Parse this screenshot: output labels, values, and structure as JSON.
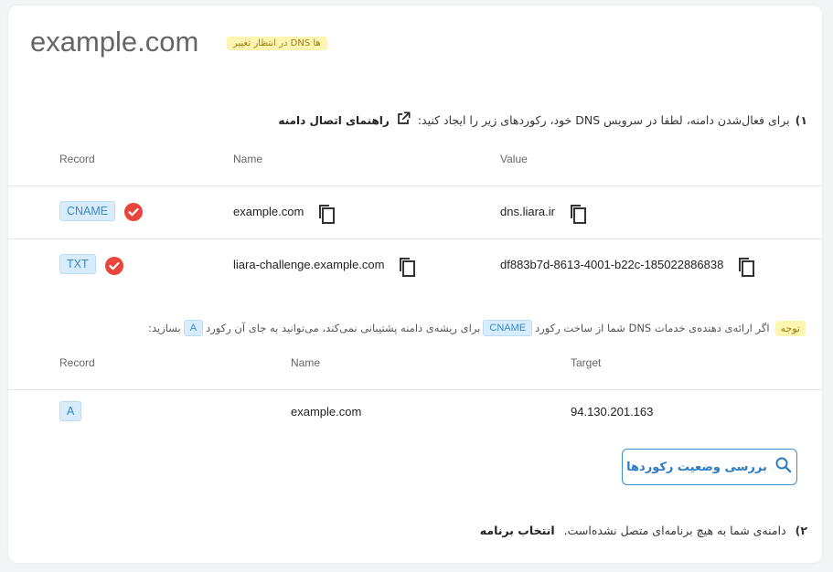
{
  "header": {
    "domain": "example.com",
    "status_badge": "در انتظار تغییر DNS ها"
  },
  "step1": {
    "number": "۱)",
    "text": "برای فعال‌شدن دامنه، لطفا در سرویس DNS خود، رکوردهای زیر را ایجاد کنید:",
    "guide_link": "راهنمای اتصال دامنه"
  },
  "table1": {
    "headers": {
      "record": "Record",
      "name": "Name",
      "value": "Value"
    },
    "rows": [
      {
        "record": "CNAME",
        "name": "example.com",
        "value": "dns.liara.ir"
      },
      {
        "record": "TXT",
        "name": "liara-challenge.example.com",
        "value": "df883b7d-8613-4001-b22c-185022886838"
      }
    ]
  },
  "note": {
    "badge": "توجه",
    "part1": "اگر ارائه‌ی دهنده‌ی خدمات DNS شما از ساخت رکورد",
    "cname": "CNAME",
    "part2": "برای ریشه‌ی دامنه پشتیبانی نمی‌کند، می‌توانید به جای آن رکورد",
    "a": "A",
    "part3": "بسازید:"
  },
  "table2": {
    "headers": {
      "record": "Record",
      "name": "Name",
      "target": "Target"
    },
    "rows": [
      {
        "record": "A",
        "name": "example.com",
        "target": "94.130.201.163"
      }
    ]
  },
  "check_button": {
    "label": "بررسی وضعیت رکوردها"
  },
  "step2": {
    "number": "۲)",
    "text": "دامنه‌ی شما به هیچ برنامه‌ای متصل نشده‌است.",
    "action": "انتخاب برنامه"
  },
  "colors": {
    "accent": "#2b7bc0",
    "success": "#e8453c",
    "tag_bg": "#d7ecfc",
    "badge_bg": "#fdf6b2"
  }
}
